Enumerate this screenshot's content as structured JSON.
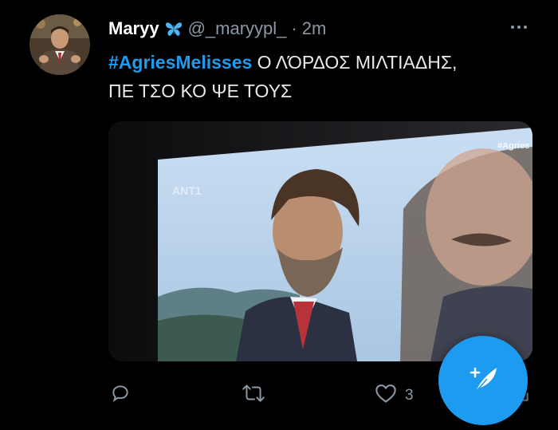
{
  "tweet": {
    "author_name": "Maryy",
    "handle": "@_maryypl_",
    "separator": "·",
    "time": "2m",
    "hashtag": "#AgriesMelisses",
    "text_line1": " Ο ΛΌΡΔΟΣ ΜΙΛΤΙΑΔΗΣ,",
    "text_line2": "ΠΕ ΤΣΟ ΚΟ ΨΕ ΤΟΥΣ",
    "likes_count": "3"
  },
  "media": {
    "overlay_hashtag": "#Agries",
    "channel_logo": "ANT1"
  },
  "icons": {
    "avatar": "avatar",
    "butterfly": "butterfly-icon",
    "more": "more-icon",
    "reply": "reply-icon",
    "retweet": "retweet-icon",
    "like": "like-icon",
    "share": "share-icon",
    "compose": "compose-tweet-icon"
  },
  "colors": {
    "accent": "#1d9bf0",
    "background": "#000000",
    "secondary_text": "#8b98a5"
  }
}
